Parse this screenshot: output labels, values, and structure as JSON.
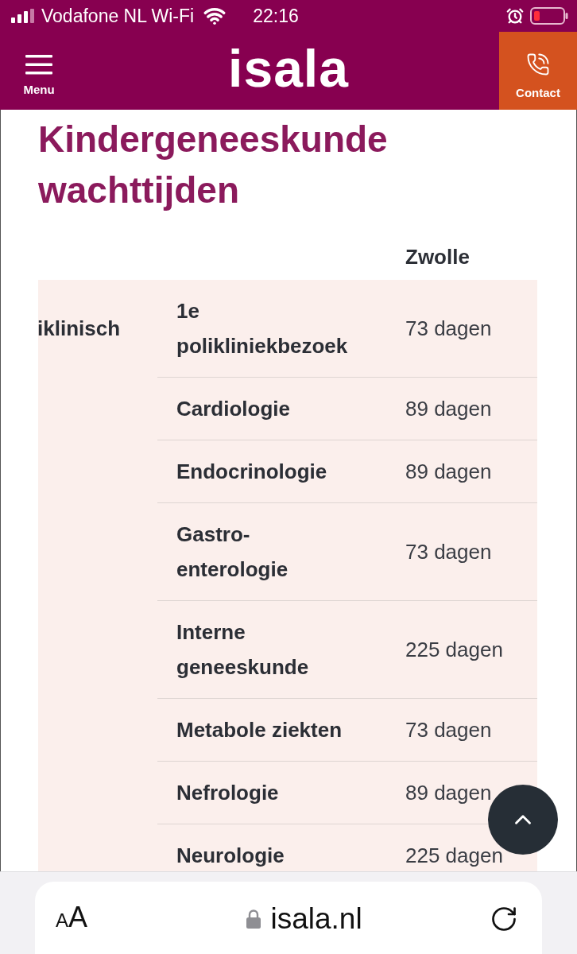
{
  "status_bar": {
    "carrier": "Vodafone NL Wi-Fi",
    "time": "22:16"
  },
  "header": {
    "menu_label": "Menu",
    "logo": "isala",
    "contact_label": "Contact"
  },
  "page": {
    "title": "Kindergeneeskunde wachttijden"
  },
  "table": {
    "column_3": "Zwolle",
    "group_label": "iklinisch",
    "rows": [
      {
        "specialty": "1e polikliniekbezoek",
        "wait": "73 dagen"
      },
      {
        "specialty": "Cardiologie",
        "wait": "89 dagen"
      },
      {
        "specialty": "Endocrinologie",
        "wait": "89 dagen"
      },
      {
        "specialty": "Gastro-enterologie",
        "wait": "73 dagen"
      },
      {
        "specialty": "Interne geneeskunde",
        "wait": "225 dagen"
      },
      {
        "specialty": "Metabole ziekten",
        "wait": "73 dagen"
      },
      {
        "specialty": "Nefrologie",
        "wait": "89 dagen"
      },
      {
        "specialty": "Neurologie",
        "wait": "225 dagen"
      }
    ]
  },
  "browser_bar": {
    "reader_button": "AA",
    "url": "isala.nl"
  }
}
